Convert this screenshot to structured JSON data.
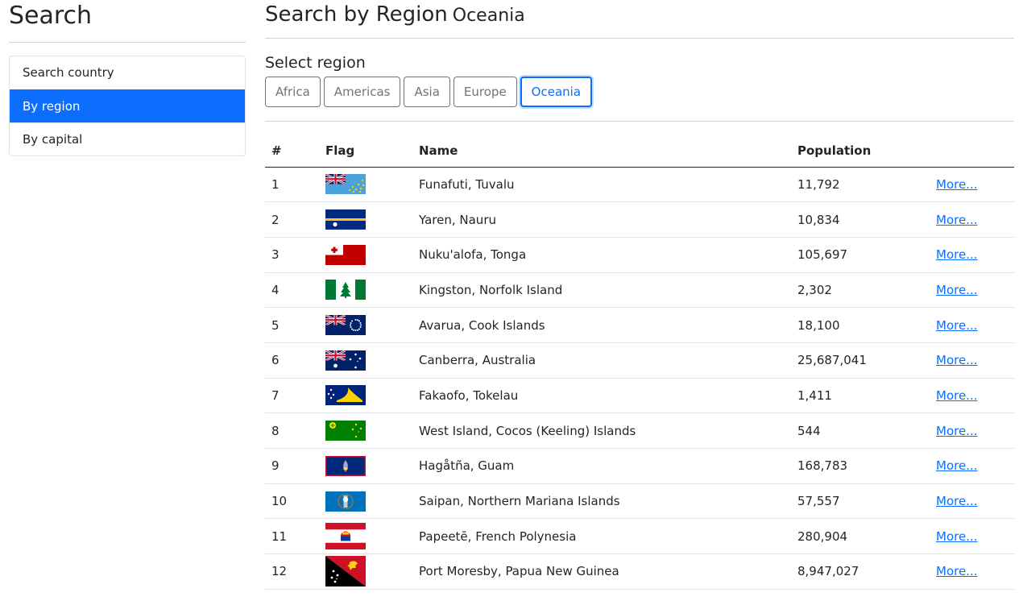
{
  "sidebar": {
    "title": "Search",
    "items": [
      {
        "label": "Search country"
      },
      {
        "label": "By region",
        "active": true
      },
      {
        "label": "By capital"
      }
    ]
  },
  "main": {
    "title_prefix": "Search by Region",
    "title_region": "Oceania",
    "select_label": "Select region",
    "regions": [
      "Africa",
      "Americas",
      "Asia",
      "Europe",
      "Oceania"
    ],
    "active_region": "Oceania",
    "table": {
      "headers": [
        "#",
        "Flag",
        "Name",
        "Population",
        ""
      ],
      "rows": [
        {
          "n": "1",
          "name": "Funafuti, Tuvalu",
          "pop": "11,792",
          "more": "More...",
          "flag": "tuvalu-flag"
        },
        {
          "n": "2",
          "name": "Yaren, Nauru",
          "pop": "10,834",
          "more": "More...",
          "flag": "nauru-flag"
        },
        {
          "n": "3",
          "name": "Nuku'alofa, Tonga",
          "pop": "105,697",
          "more": "More...",
          "flag": "tonga-flag"
        },
        {
          "n": "4",
          "name": "Kingston, Norfolk Island",
          "pop": "2,302",
          "more": "More...",
          "flag": "norfolk-island-flag"
        },
        {
          "n": "5",
          "name": "Avarua, Cook Islands",
          "pop": "18,100",
          "more": "More...",
          "flag": "cook-islands-flag"
        },
        {
          "n": "6",
          "name": "Canberra, Australia",
          "pop": "25,687,041",
          "more": "More...",
          "flag": "australia-flag"
        },
        {
          "n": "7",
          "name": "Fakaofo, Tokelau",
          "pop": "1,411",
          "more": "More...",
          "flag": "tokelau-flag"
        },
        {
          "n": "8",
          "name": "West Island, Cocos (Keeling) Islands",
          "pop": "544",
          "more": "More...",
          "flag": "cocos-islands-flag"
        },
        {
          "n": "9",
          "name": "Hagåtña, Guam",
          "pop": "168,783",
          "more": "More...",
          "flag": "guam-flag"
        },
        {
          "n": "10",
          "name": "Saipan, Northern Mariana Islands",
          "pop": "57,557",
          "more": "More...",
          "flag": "northern-mariana-islands-flag"
        },
        {
          "n": "11",
          "name": "Papeetē, French Polynesia",
          "pop": "280,904",
          "more": "More...",
          "flag": "french-polynesia-flag"
        },
        {
          "n": "12",
          "name": "Port Moresby, Papua New Guinea",
          "pop": "8,947,027",
          "more": "More...",
          "flag": "papua-new-guinea-flag"
        }
      ]
    }
  },
  "colors": {
    "primary": "#0d6efd",
    "secondary": "#6c757d",
    "text": "#212529"
  }
}
